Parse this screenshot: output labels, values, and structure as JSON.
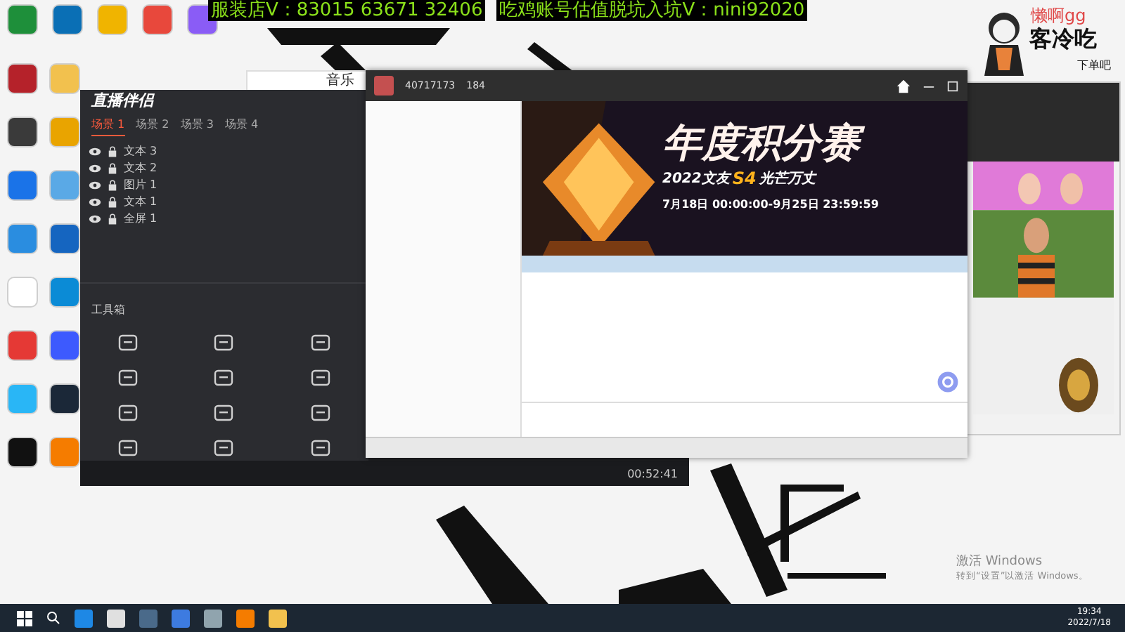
{
  "banner": {
    "left": "服装店V：83015 63671 32406",
    "right": "吃鸡账号估值脱坑入坑V：nini92020"
  },
  "sticker": {
    "name": "懒啊gg",
    "slogan": "客冷吃",
    "sub": "下单吧"
  },
  "desktop_icons": [
    {
      "color": "#1e8f3a"
    },
    {
      "color": "#0a6fb5"
    },
    {
      "color": "#f0b400"
    },
    {
      "color": "#e8483c"
    },
    {
      "color": "#8a5cf6"
    },
    {
      "color": "#b5222a"
    },
    {
      "color": "#f2c14e"
    },
    {
      "color": "#3a3a3a"
    },
    {
      "color": "#e9a400"
    },
    {
      "color": "#1a73e8"
    },
    {
      "color": "#5aa9e6"
    },
    {
      "color": "#2a8de0"
    },
    {
      "color": "#1565c0"
    },
    {
      "color": "#ffffff"
    },
    {
      "color": "#0b8bd6"
    },
    {
      "color": "#e53935"
    },
    {
      "color": "#3d5afe"
    },
    {
      "color": "#29b6f6"
    },
    {
      "color": "#1b2838"
    },
    {
      "color": "#111111"
    },
    {
      "color": "#f57c00"
    }
  ],
  "behind_window": {
    "title": "音乐"
  },
  "streamer_window": {
    "title": "直播伴侣",
    "scenes": [
      {
        "label": "场景 1",
        "selected": true
      },
      {
        "label": "场景 2",
        "selected": false
      },
      {
        "label": "场景 3",
        "selected": false
      },
      {
        "label": "场景 4",
        "selected": false
      }
    ],
    "sources": [
      {
        "label": "文本 3",
        "visible": true
      },
      {
        "label": "文本 2",
        "visible": true
      },
      {
        "label": "图片 1",
        "visible": true
      },
      {
        "label": "文本 1",
        "visible": true
      },
      {
        "label": "全屏 1",
        "visible": true
      }
    ],
    "toolbox": "工具箱",
    "timer": "00:52:41"
  },
  "chat_window": {
    "room_id": "40717173",
    "viewers": "184",
    "event": {
      "title": "年度积分赛",
      "subtitle_a": "2022文友",
      "badge": "S4",
      "subtitle_b": "光芒万丈",
      "dates": "7月18日 00:00:00-9月25日 23:59:59"
    }
  },
  "activation": {
    "title": "激活 Windows",
    "hint": "转到“设置”以激活 Windows。"
  },
  "taskbar": {
    "time": "19:34",
    "date": "2022/7/18"
  }
}
